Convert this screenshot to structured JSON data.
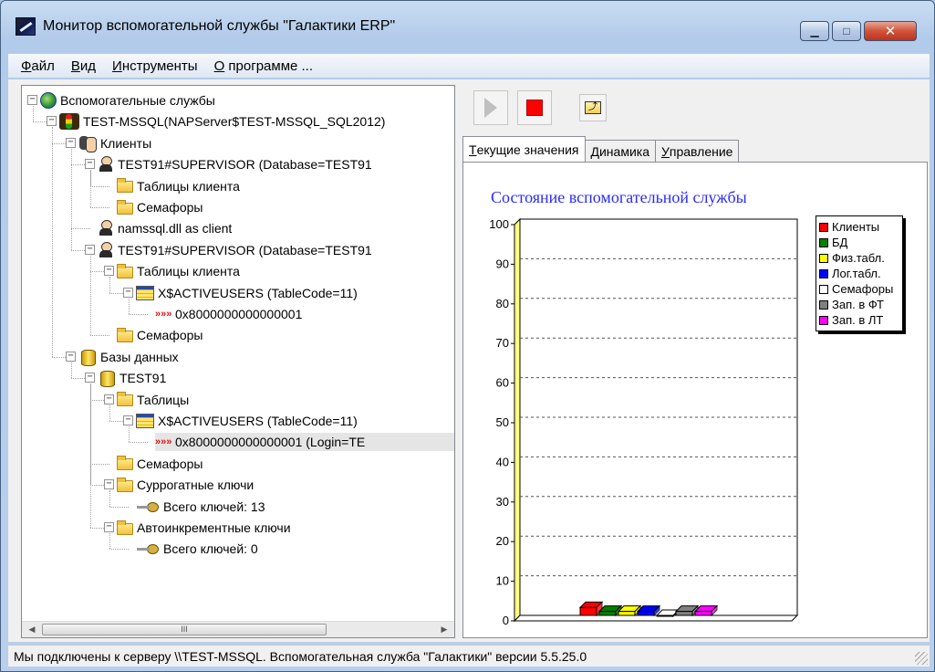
{
  "window": {
    "title": "Монитор вспомогательной службы \"Галактики ERP\"",
    "min_glyph": "▁",
    "max_glyph": "□",
    "close_glyph": "✕"
  },
  "menu": {
    "items": [
      {
        "label": "Файл",
        "accel": "Ф"
      },
      {
        "label": "Вид",
        "accel": "В"
      },
      {
        "label": "Инструменты",
        "accel": "И"
      },
      {
        "label": "О программе ...",
        "accel": "О"
      }
    ]
  },
  "tree": {
    "nodes": [
      {
        "label": "Вспомогательные службы",
        "icon": "globe-icon",
        "expander": "−"
      },
      {
        "label": "TEST-MSSQL(NAPServer$TEST-MSSQL_SQL2012)",
        "icon": "traffic-light-icon",
        "expander": "−"
      },
      {
        "label": "Клиенты",
        "icon": "clients-icon",
        "expander": "−"
      },
      {
        "label": "TEST91#SUPERVISOR (Database=TEST91",
        "icon": "user-icon",
        "expander": "−"
      },
      {
        "label": "Таблицы клиента",
        "icon": "folder-icon",
        "expander": ""
      },
      {
        "label": "Семафоры",
        "icon": "folder-icon",
        "expander": ""
      },
      {
        "label": "namssql.dll as client",
        "icon": "user-icon",
        "expander": ""
      },
      {
        "label": "TEST91#SUPERVISOR (Database=TEST91",
        "icon": "user-icon",
        "expander": "−"
      },
      {
        "label": "Таблицы клиента",
        "icon": "folder-icon",
        "expander": "−"
      },
      {
        "label": "X$ACTIVEUSERS (TableCode=11)",
        "icon": "table-icon",
        "expander": "−"
      },
      {
        "label": "0x8000000000000001",
        "icon": "record-arrows-icon",
        "expander": ""
      },
      {
        "label": "Семафоры",
        "icon": "folder-icon",
        "expander": ""
      },
      {
        "label": "Базы данных",
        "icon": "databases-icon",
        "expander": "−"
      },
      {
        "label": "TEST91",
        "icon": "database-icon",
        "expander": "−"
      },
      {
        "label": "Таблицы",
        "icon": "folder-icon",
        "expander": "−"
      },
      {
        "label": "X$ACTIVEUSERS (TableCode=11)",
        "icon": "table-icon",
        "expander": "−"
      },
      {
        "label": "0x8000000000000001 (Login=TE",
        "icon": "record-arrows-icon",
        "expander": ""
      },
      {
        "label": "Семафоры",
        "icon": "folder-icon",
        "expander": ""
      },
      {
        "label": "Суррогатные ключи",
        "icon": "folder-icon",
        "expander": "−"
      },
      {
        "label": "Всего ключей: 13",
        "icon": "key-icon",
        "expander": ""
      },
      {
        "label": "Автоинкрементные ключи",
        "icon": "folder-icon",
        "expander": "−"
      },
      {
        "label": "Всего ключей: 0",
        "icon": "key-icon",
        "expander": ""
      }
    ],
    "arrows_glyph": "»",
    "scroll_left": "◀",
    "scroll_right": "▶",
    "thumb_grip": "III"
  },
  "toolbar": {
    "start_button": "start-icon",
    "stop_button": "stop-icon",
    "folder_up_button": "folder-up-icon",
    "folder_up_glyph": "⤴"
  },
  "tabs": [
    {
      "label": "Текущие значения",
      "accel": "Т",
      "active": true
    },
    {
      "label": "Динамика",
      "accel": "Д",
      "active": false
    },
    {
      "label": "Управление",
      "accel": "У",
      "active": false
    }
  ],
  "chart_data": {
    "type": "bar",
    "title": "Состояние вспомогательной службы",
    "categories": [
      "Клиенты",
      "БД",
      "Физ.табл.",
      "Лог.табл.",
      "Семафоры",
      "Зап. в ФТ",
      "Зап. в ЛТ"
    ],
    "values": [
      2,
      1,
      1,
      1,
      0,
      1,
      1
    ],
    "colors": [
      "#ff0000",
      "#008000",
      "#ffff00",
      "#0000ff",
      "#ffffff",
      "#808080",
      "#ff00ff"
    ],
    "ylim": [
      0,
      100
    ],
    "yticks": [
      0,
      10,
      20,
      30,
      40,
      50,
      60,
      70,
      80,
      90,
      100
    ],
    "grid": true,
    "legend": "top-right",
    "axis_wall_color": "#ffff80"
  },
  "status": {
    "text": "Мы подключены к серверу \\\\TEST-MSSQL. Вспомогательная служба \"Галактики\" версии 5.5.25.0"
  }
}
